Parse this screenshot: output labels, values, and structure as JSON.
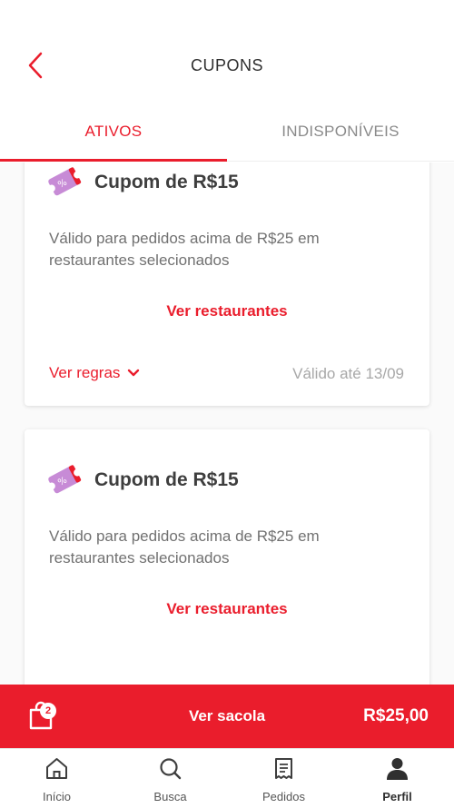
{
  "header": {
    "title": "CUPONS",
    "back_icon": "chevron-left-icon"
  },
  "tabs": [
    {
      "label": "ATIVOS",
      "active": true
    },
    {
      "label": "INDISPONÍVEIS",
      "active": false
    }
  ],
  "coupons": [
    {
      "icon": "coupon-ticket-icon",
      "title": "Cupom de R$15",
      "description": "Válido para pedidos acima de R$25 em restaurantes selecionados",
      "link_label": "Ver restaurantes",
      "rules_label": "Ver regras",
      "valid_until": "Válido até 13/09"
    },
    {
      "icon": "coupon-ticket-icon",
      "title": "Cupom de R$15",
      "description": "Válido para pedidos acima de R$25 em restaurantes selecionados",
      "link_label": "Ver restaurantes"
    }
  ],
  "bag": {
    "count": "2",
    "label": "Ver sacola",
    "total": "R$25,00"
  },
  "bottom_nav": [
    {
      "label": "Início",
      "icon": "home-icon",
      "active": false
    },
    {
      "label": "Busca",
      "icon": "search-icon",
      "active": false
    },
    {
      "label": "Pedidos",
      "icon": "orders-icon",
      "active": false
    },
    {
      "label": "Perfil",
      "icon": "user-icon",
      "active": true
    }
  ],
  "colors": {
    "accent": "#ea1d2c",
    "coupon_icon": "#c78bd6",
    "text_primary": "#3e3e3e",
    "text_secondary": "#717171"
  }
}
